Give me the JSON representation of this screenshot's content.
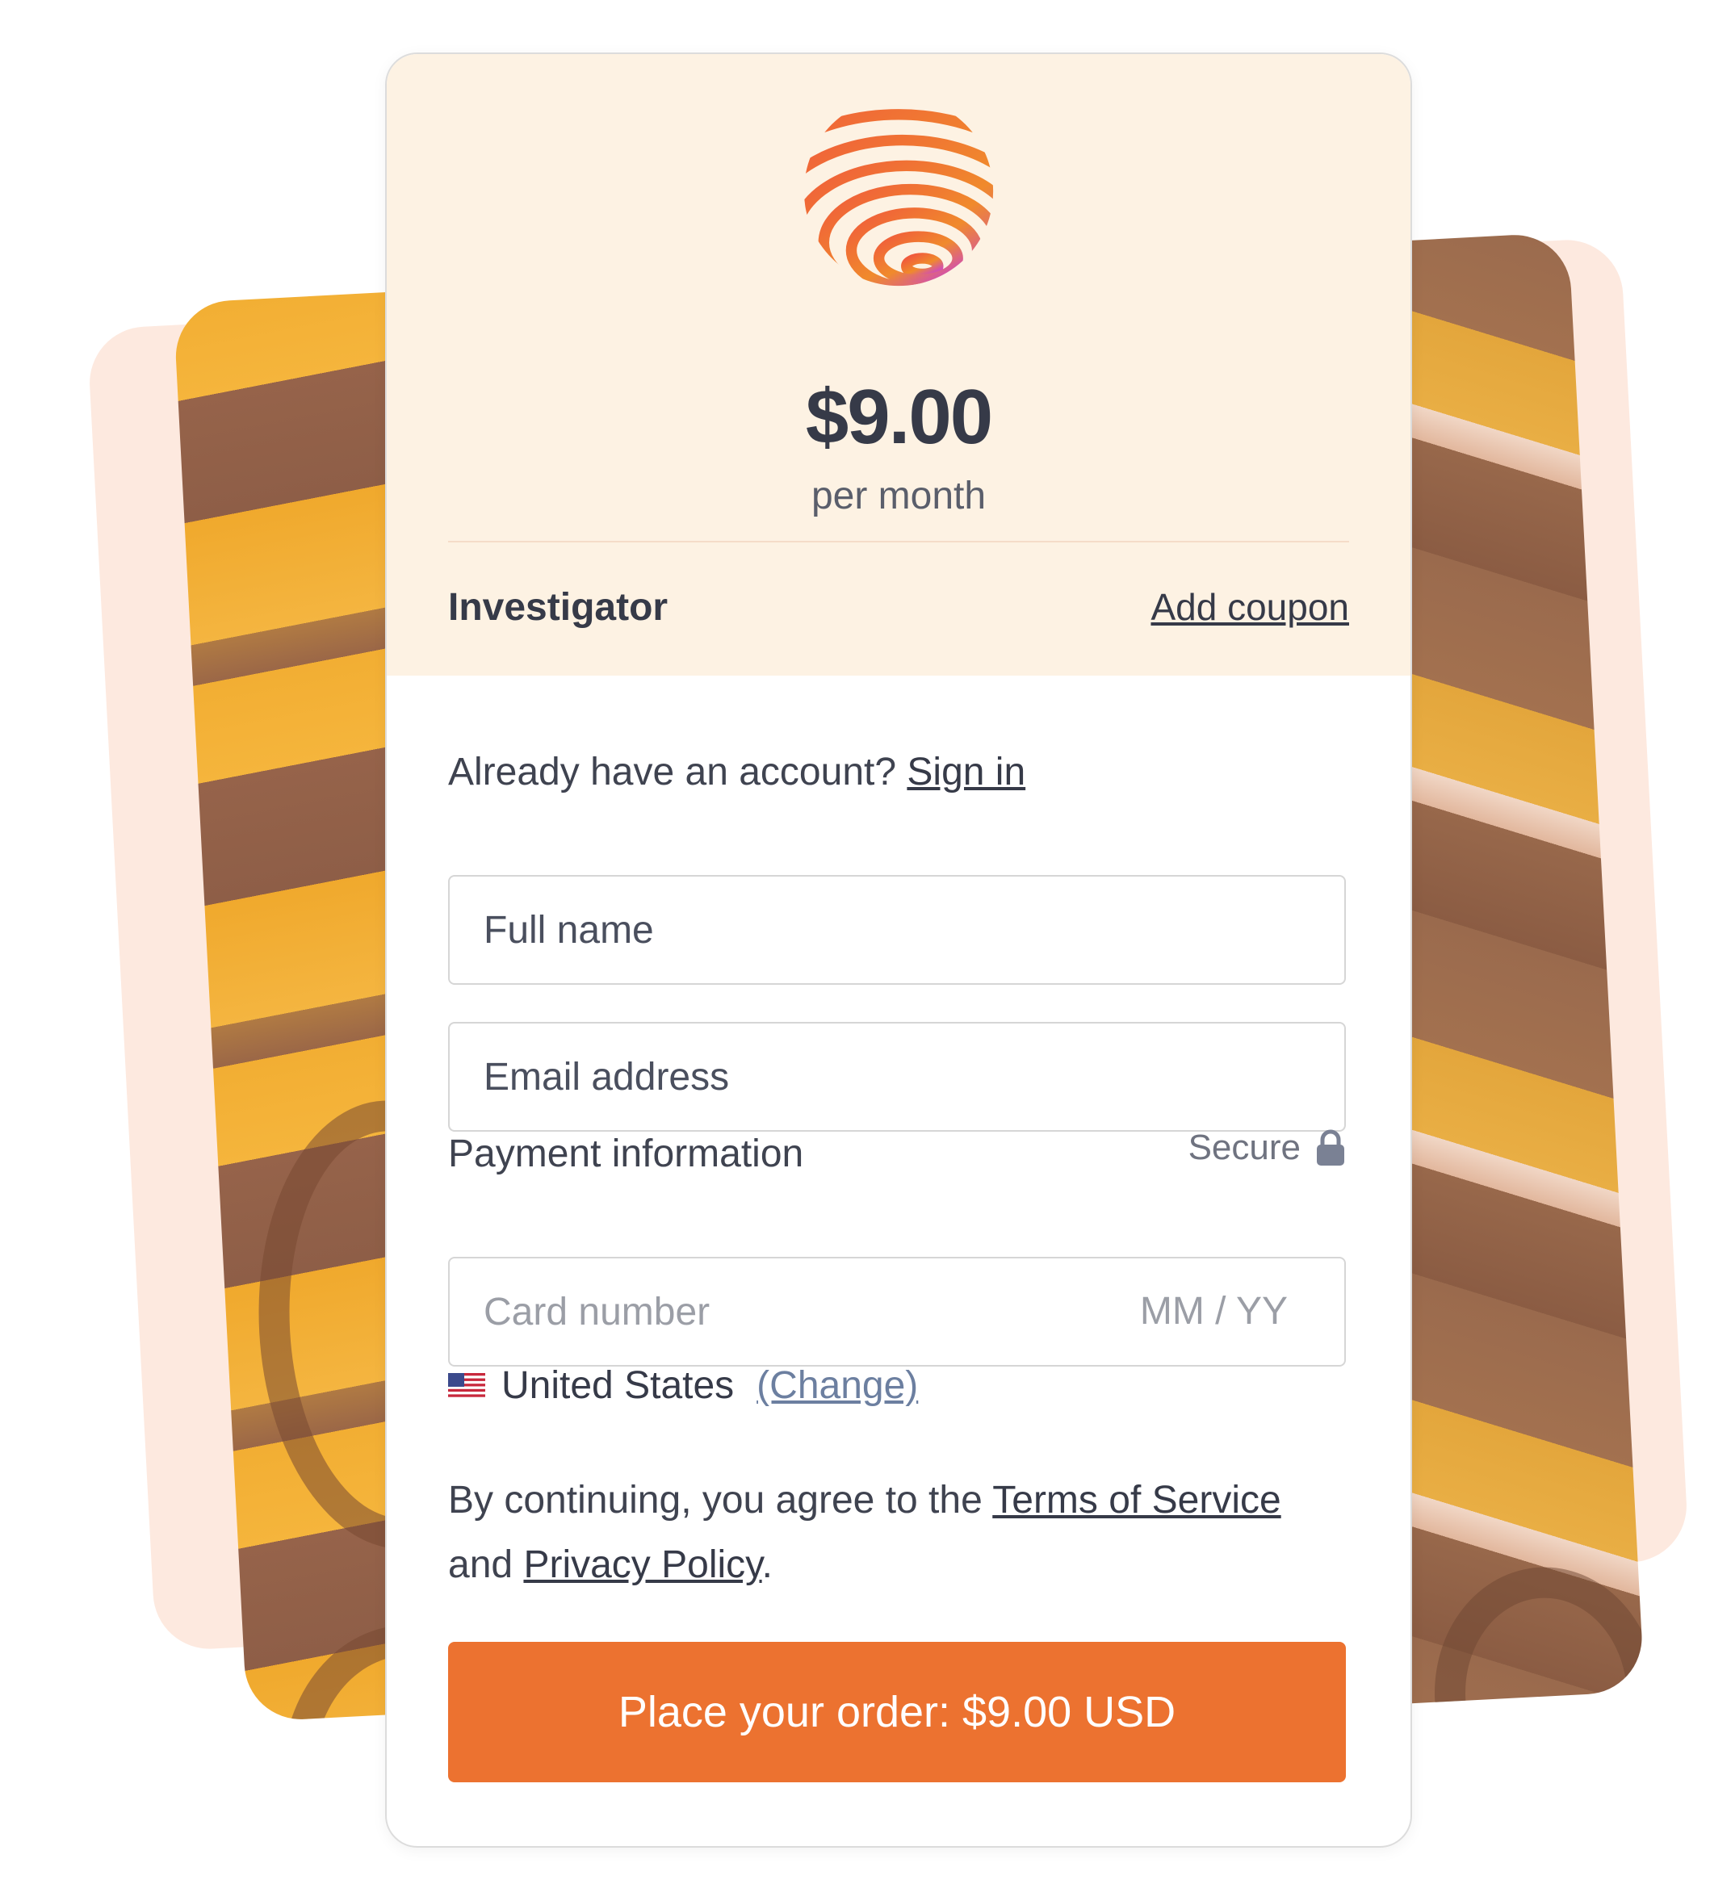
{
  "plan": {
    "price": "$9.00",
    "period": "per month",
    "name": "Investigator",
    "coupon_label": "Add coupon"
  },
  "account": {
    "prompt": "Already have an account?",
    "sign_in_label": "Sign in"
  },
  "form": {
    "full_name_placeholder": "Full name",
    "email_placeholder": "Email address",
    "payment_label": "Payment information",
    "secure_label": "Secure",
    "card_number_placeholder": "Card number",
    "expiry_placeholder": "MM / YY",
    "country": "United States",
    "change_label": "(Change)"
  },
  "terms": {
    "prefix": "By continuing, you agree to the",
    "tos_label": "Terms of Service",
    "and": "and",
    "privacy_label": "Privacy Policy",
    "suffix": "."
  },
  "order_button_label": "Place your order: $9.00 USD",
  "icons": {
    "logo": "striped-globe-logo",
    "lock": "lock-icon",
    "flag": "us-flag-icon"
  },
  "colors": {
    "accent": "#ec7230",
    "header_background": "#fdf2e3",
    "text": "#363a48",
    "change_link": "#6c7fa0"
  }
}
